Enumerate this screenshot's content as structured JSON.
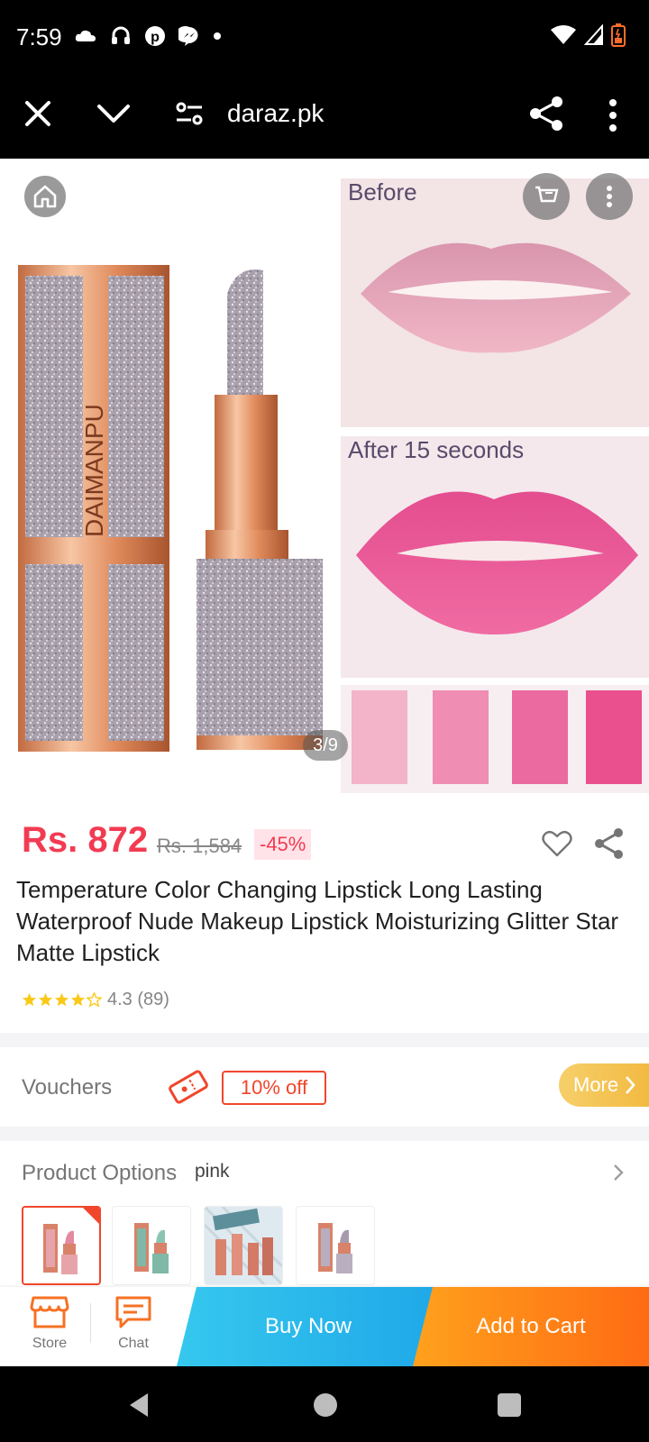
{
  "status_bar": {
    "time": "7:59",
    "icons_left": [
      "cloud-icon",
      "headset-icon",
      "pinterest-icon",
      "messenger-icon",
      "dot-icon"
    ],
    "icons_right": [
      "wifi-icon",
      "signal-icon",
      "battery-icon"
    ]
  },
  "browser": {
    "url": "daraz.pk",
    "icons": [
      "close-icon",
      "chevron-down-icon",
      "site-settings-icon",
      "share-icon",
      "more-vert-icon"
    ]
  },
  "gallery": {
    "counter": "3/9",
    "label_before": "Before",
    "label_after": "After 15 seconds",
    "product_brand_text": "DAIMANPU",
    "colors": {
      "accent": "#f23b52",
      "brand_orange": "#f0462c"
    }
  },
  "product": {
    "price": "Rs. 872",
    "original_price": "Rs. 1,584",
    "discount": "-45%",
    "title": "Temperature Color Changing Lipstick Long Lasting Waterproof Nude Makeup Lipstick Moisturizing Glitter Star Matte Lipstick",
    "rating_value": 4.3,
    "rating_text": "4.3 (89)"
  },
  "vouchers": {
    "label": "Vouchers",
    "chip": "10% off",
    "more_label": "More"
  },
  "options": {
    "label": "Product Options",
    "value": "pink"
  },
  "action_bar": {
    "store_label": "Store",
    "chat_label": "Chat",
    "buy_now": "Buy Now",
    "add_to_cart": "Add to Cart"
  }
}
